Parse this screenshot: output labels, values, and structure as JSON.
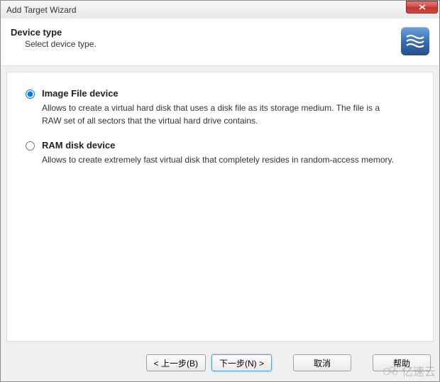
{
  "window": {
    "title": "Add Target Wizard"
  },
  "header": {
    "title": "Device type",
    "subtitle": "Select device type."
  },
  "options": [
    {
      "id": "image-file",
      "title": "Image File device",
      "description": "Allows to create a virtual hard disk that uses a disk file as its storage medium. The file is a RAW set of all sectors that the virtual hard drive contains.",
      "selected": true
    },
    {
      "id": "ram-disk",
      "title": "RAM disk device",
      "description": "Allows to create extremely fast virtual disk that completely resides in random-access memory.",
      "selected": false
    }
  ],
  "buttons": {
    "back": "< 上一步(B)",
    "next": "下一步(N) >",
    "cancel": "取消",
    "help": "帮助"
  },
  "watermark": "亿速云"
}
